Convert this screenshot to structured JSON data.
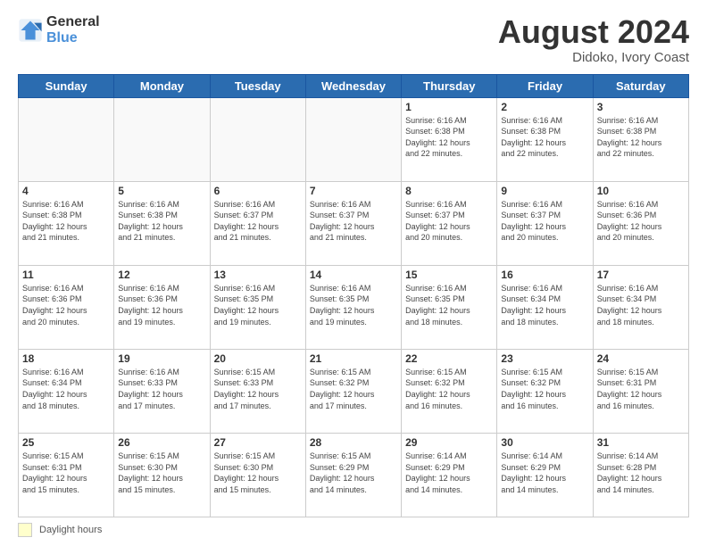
{
  "logo": {
    "line1": "General",
    "line2": "Blue"
  },
  "header": {
    "month": "August 2024",
    "location": "Didoko, Ivory Coast"
  },
  "weekdays": [
    "Sunday",
    "Monday",
    "Tuesday",
    "Wednesday",
    "Thursday",
    "Friday",
    "Saturday"
  ],
  "legend_label": "Daylight hours",
  "weeks": [
    [
      {
        "day": "",
        "info": ""
      },
      {
        "day": "",
        "info": ""
      },
      {
        "day": "",
        "info": ""
      },
      {
        "day": "",
        "info": ""
      },
      {
        "day": "1",
        "info": "Sunrise: 6:16 AM\nSunset: 6:38 PM\nDaylight: 12 hours\nand 22 minutes."
      },
      {
        "day": "2",
        "info": "Sunrise: 6:16 AM\nSunset: 6:38 PM\nDaylight: 12 hours\nand 22 minutes."
      },
      {
        "day": "3",
        "info": "Sunrise: 6:16 AM\nSunset: 6:38 PM\nDaylight: 12 hours\nand 22 minutes."
      }
    ],
    [
      {
        "day": "4",
        "info": "Sunrise: 6:16 AM\nSunset: 6:38 PM\nDaylight: 12 hours\nand 21 minutes."
      },
      {
        "day": "5",
        "info": "Sunrise: 6:16 AM\nSunset: 6:38 PM\nDaylight: 12 hours\nand 21 minutes."
      },
      {
        "day": "6",
        "info": "Sunrise: 6:16 AM\nSunset: 6:37 PM\nDaylight: 12 hours\nand 21 minutes."
      },
      {
        "day": "7",
        "info": "Sunrise: 6:16 AM\nSunset: 6:37 PM\nDaylight: 12 hours\nand 21 minutes."
      },
      {
        "day": "8",
        "info": "Sunrise: 6:16 AM\nSunset: 6:37 PM\nDaylight: 12 hours\nand 20 minutes."
      },
      {
        "day": "9",
        "info": "Sunrise: 6:16 AM\nSunset: 6:37 PM\nDaylight: 12 hours\nand 20 minutes."
      },
      {
        "day": "10",
        "info": "Sunrise: 6:16 AM\nSunset: 6:36 PM\nDaylight: 12 hours\nand 20 minutes."
      }
    ],
    [
      {
        "day": "11",
        "info": "Sunrise: 6:16 AM\nSunset: 6:36 PM\nDaylight: 12 hours\nand 20 minutes."
      },
      {
        "day": "12",
        "info": "Sunrise: 6:16 AM\nSunset: 6:36 PM\nDaylight: 12 hours\nand 19 minutes."
      },
      {
        "day": "13",
        "info": "Sunrise: 6:16 AM\nSunset: 6:35 PM\nDaylight: 12 hours\nand 19 minutes."
      },
      {
        "day": "14",
        "info": "Sunrise: 6:16 AM\nSunset: 6:35 PM\nDaylight: 12 hours\nand 19 minutes."
      },
      {
        "day": "15",
        "info": "Sunrise: 6:16 AM\nSunset: 6:35 PM\nDaylight: 12 hours\nand 18 minutes."
      },
      {
        "day": "16",
        "info": "Sunrise: 6:16 AM\nSunset: 6:34 PM\nDaylight: 12 hours\nand 18 minutes."
      },
      {
        "day": "17",
        "info": "Sunrise: 6:16 AM\nSunset: 6:34 PM\nDaylight: 12 hours\nand 18 minutes."
      }
    ],
    [
      {
        "day": "18",
        "info": "Sunrise: 6:16 AM\nSunset: 6:34 PM\nDaylight: 12 hours\nand 18 minutes."
      },
      {
        "day": "19",
        "info": "Sunrise: 6:16 AM\nSunset: 6:33 PM\nDaylight: 12 hours\nand 17 minutes."
      },
      {
        "day": "20",
        "info": "Sunrise: 6:15 AM\nSunset: 6:33 PM\nDaylight: 12 hours\nand 17 minutes."
      },
      {
        "day": "21",
        "info": "Sunrise: 6:15 AM\nSunset: 6:32 PM\nDaylight: 12 hours\nand 17 minutes."
      },
      {
        "day": "22",
        "info": "Sunrise: 6:15 AM\nSunset: 6:32 PM\nDaylight: 12 hours\nand 16 minutes."
      },
      {
        "day": "23",
        "info": "Sunrise: 6:15 AM\nSunset: 6:32 PM\nDaylight: 12 hours\nand 16 minutes."
      },
      {
        "day": "24",
        "info": "Sunrise: 6:15 AM\nSunset: 6:31 PM\nDaylight: 12 hours\nand 16 minutes."
      }
    ],
    [
      {
        "day": "25",
        "info": "Sunrise: 6:15 AM\nSunset: 6:31 PM\nDaylight: 12 hours\nand 15 minutes."
      },
      {
        "day": "26",
        "info": "Sunrise: 6:15 AM\nSunset: 6:30 PM\nDaylight: 12 hours\nand 15 minutes."
      },
      {
        "day": "27",
        "info": "Sunrise: 6:15 AM\nSunset: 6:30 PM\nDaylight: 12 hours\nand 15 minutes."
      },
      {
        "day": "28",
        "info": "Sunrise: 6:15 AM\nSunset: 6:29 PM\nDaylight: 12 hours\nand 14 minutes."
      },
      {
        "day": "29",
        "info": "Sunrise: 6:14 AM\nSunset: 6:29 PM\nDaylight: 12 hours\nand 14 minutes."
      },
      {
        "day": "30",
        "info": "Sunrise: 6:14 AM\nSunset: 6:29 PM\nDaylight: 12 hours\nand 14 minutes."
      },
      {
        "day": "31",
        "info": "Sunrise: 6:14 AM\nSunset: 6:28 PM\nDaylight: 12 hours\nand 14 minutes."
      }
    ]
  ]
}
